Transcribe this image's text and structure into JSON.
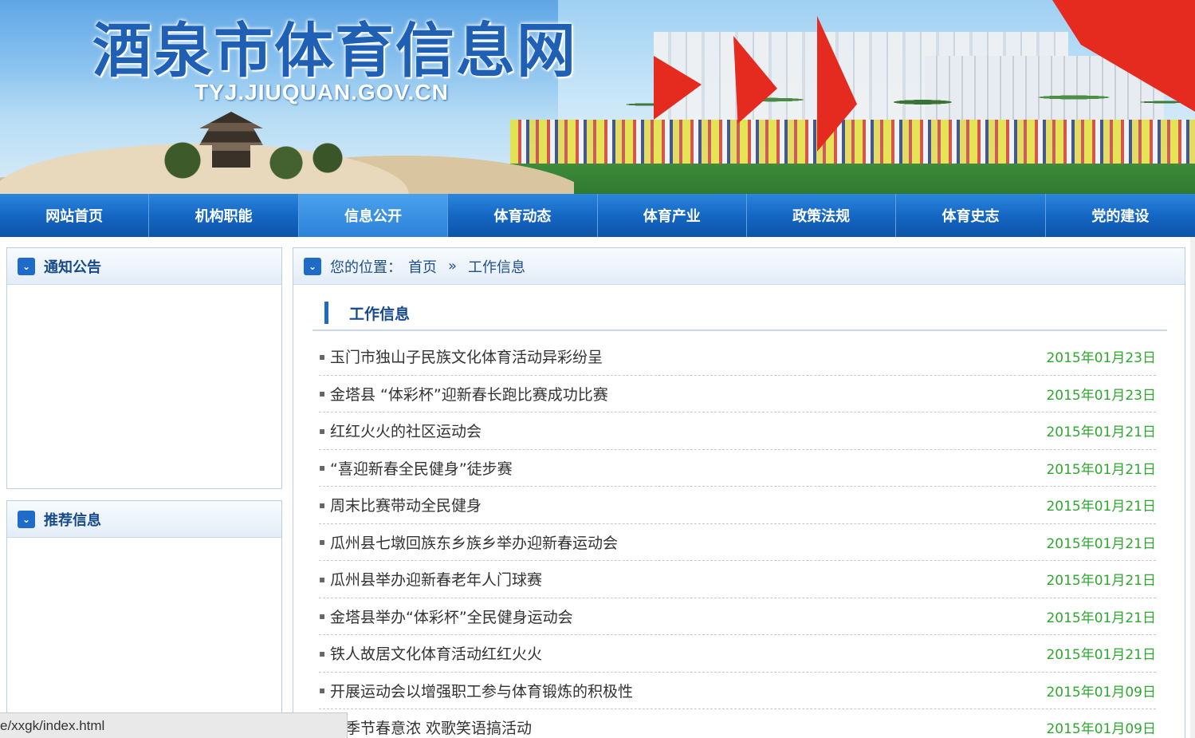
{
  "banner": {
    "title": "酒泉市体育信息网",
    "subtitle": "TYJ.JIUQUAN.GOV.CN"
  },
  "nav": {
    "items": [
      {
        "label": "网站首页"
      },
      {
        "label": "机构职能"
      },
      {
        "label": "信息公开",
        "active": true
      },
      {
        "label": "体育动态"
      },
      {
        "label": "体育产业"
      },
      {
        "label": "政策法规"
      },
      {
        "label": "体育史志"
      },
      {
        "label": "党的建设"
      }
    ]
  },
  "sidebar": {
    "notice": {
      "title": "通知公告",
      "icon": "chevron-down-icon"
    },
    "recommend": {
      "title": "推荐信息",
      "icon": "chevron-down-icon"
    }
  },
  "breadcrumb": {
    "prefix": "您的位置：",
    "home": "首页",
    "separator": "»",
    "current": "工作信息"
  },
  "section": {
    "title": "工作信息"
  },
  "articles": [
    {
      "title": "玉门市独山子民族文化体育活动异彩纷呈",
      "date": "2015年01月23日"
    },
    {
      "title": "金塔县 “体彩杯”迎新春长跑比赛成功比赛",
      "date": "2015年01月23日"
    },
    {
      "title": "红红火火的社区运动会",
      "date": "2015年01月21日"
    },
    {
      "title": "“喜迎新春全民健身”徒步赛",
      "date": "2015年01月21日"
    },
    {
      "title": "周末比赛带动全民健身",
      "date": "2015年01月21日"
    },
    {
      "title": "瓜州县七墩回族东乡族乡举办迎新春运动会",
      "date": "2015年01月21日"
    },
    {
      "title": "瓜州县举办迎新春老年人门球赛",
      "date": "2015年01月21日"
    },
    {
      "title": "金塔县举办“体彩杯”全民健身运动会",
      "date": "2015年01月21日"
    },
    {
      "title": "铁人故居文化体育活动红红火火",
      "date": "2015年01月21日"
    },
    {
      "title": "开展运动会以增强职工参与体育锻炼的积极性",
      "date": "2015年01月09日"
    },
    {
      "title": "冬季节春意浓 欢歌笑语搞活动",
      "date": "2015年01月09日"
    }
  ],
  "statusbar": {
    "url": "e/xxgk/index.html"
  },
  "colors": {
    "nav": "#1567c3",
    "title": "#1f5fb4",
    "date": "#2ea82e",
    "heading": "#174a8a"
  }
}
